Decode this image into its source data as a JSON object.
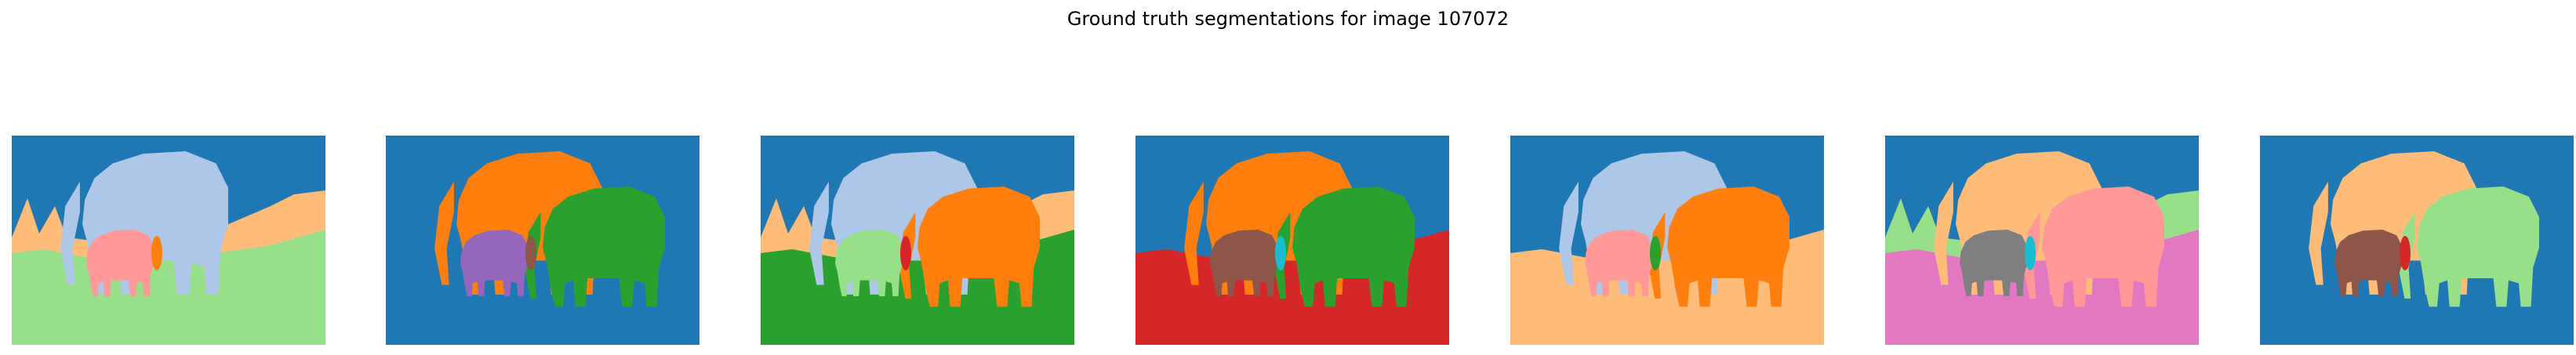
{
  "figure": {
    "title": "Ground truth segmentations for image 107072"
  },
  "panels": [
    {
      "sky": "#1f77b4",
      "ground": "#98df8a",
      "big": "#aec7e8",
      "small": "#ff9896",
      "third": null,
      "accent": "#ff7f0e",
      "mid": "#ffbb78"
    },
    {
      "sky": "#1f77b4",
      "ground": "#1f77b4",
      "big": "#ff7f0e",
      "small": "#9467bd",
      "third": "#2ca02c",
      "accent": "#8c564b",
      "mid": null
    },
    {
      "sky": "#1f77b4",
      "ground": "#2ca02c",
      "big": "#aec7e8",
      "small": "#98df8a",
      "third": "#ff7f0e",
      "accent": "#d62728",
      "mid": "#ffbb78"
    },
    {
      "sky": "#1f77b4",
      "ground": "#d62728",
      "big": "#ff7f0e",
      "small": "#8c564b",
      "third": "#2ca02c",
      "accent": "#17becf",
      "mid": null
    },
    {
      "sky": "#1f77b4",
      "ground": "#ffbb78",
      "big": "#aec7e8",
      "small": "#ff9896",
      "third": "#ff7f0e",
      "accent": "#2ca02c",
      "mid": null
    },
    {
      "sky": "#1f77b4",
      "ground": "#e377c2",
      "big": "#ffbb78",
      "small": "#7f7f7f",
      "third": "#ff9896",
      "accent": "#17becf",
      "mid": "#98df8a"
    },
    {
      "sky": "#1f77b4",
      "ground": "#1f77b4",
      "big": "#ffbb78",
      "small": "#8c564b",
      "third": "#98df8a",
      "accent": "#d62728",
      "mid": null
    }
  ]
}
